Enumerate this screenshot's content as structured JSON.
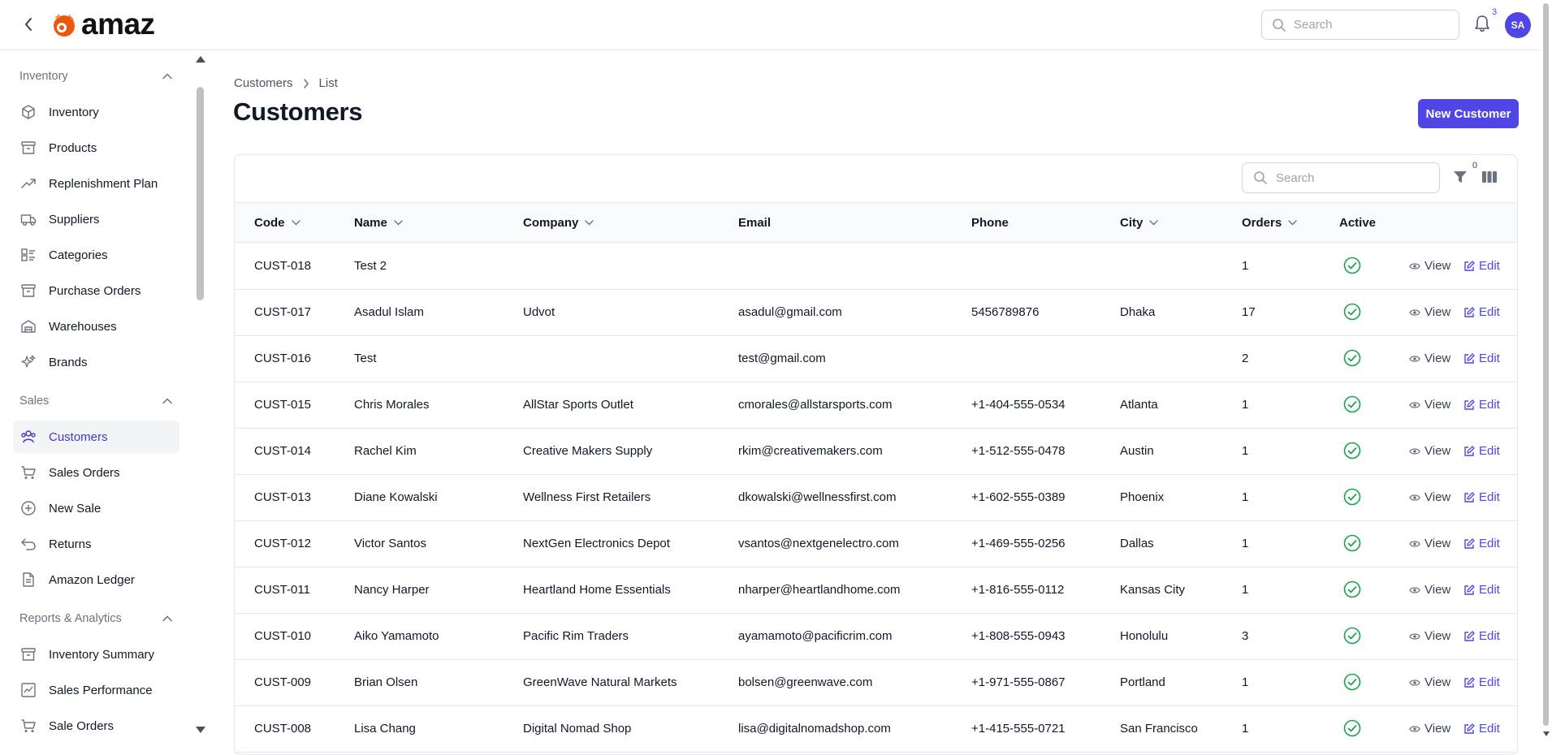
{
  "app": {
    "logo_text": "amaz",
    "notification_count": "3",
    "avatar_initials": "SA",
    "search_placeholder": "Search"
  },
  "sidebar": {
    "sections": [
      {
        "title": "Inventory",
        "items": [
          "Inventory",
          "Products",
          "Replenishment Plan",
          "Suppliers",
          "Categories",
          "Purchase Orders",
          "Warehouses",
          "Brands"
        ]
      },
      {
        "title": "Sales",
        "items": [
          "Customers",
          "Sales Orders",
          "New Sale",
          "Returns",
          "Amazon Ledger"
        ]
      },
      {
        "title": "Reports & Analytics",
        "items": [
          "Inventory Summary",
          "Sales Performance",
          "Sale Orders"
        ]
      }
    ],
    "active_item": "Customers"
  },
  "breadcrumb": {
    "root": "Customers",
    "current": "List"
  },
  "page": {
    "title": "Customers",
    "new_button": "New Customer"
  },
  "table": {
    "search_placeholder": "Search",
    "filter_count": "0",
    "columns": [
      "Code",
      "Name",
      "Company",
      "Email",
      "Phone",
      "City",
      "Orders",
      "Active"
    ],
    "view_label": "View",
    "edit_label": "Edit",
    "rows": [
      {
        "code": "CUST-018",
        "name": "Test 2",
        "company": "",
        "email": "",
        "phone": "",
        "city": "",
        "orders": "1",
        "active": true
      },
      {
        "code": "CUST-017",
        "name": "Asadul Islam",
        "company": "Udvot",
        "email": "asadul@gmail.com",
        "phone": "5456789876",
        "city": "Dhaka",
        "orders": "17",
        "active": true
      },
      {
        "code": "CUST-016",
        "name": "Test",
        "company": "",
        "email": "test@gmail.com",
        "phone": "",
        "city": "",
        "orders": "2",
        "active": true
      },
      {
        "code": "CUST-015",
        "name": "Chris Morales",
        "company": "AllStar Sports Outlet",
        "email": "cmorales@allstarsports.com",
        "phone": "+1-404-555-0534",
        "city": "Atlanta",
        "orders": "1",
        "active": true
      },
      {
        "code": "CUST-014",
        "name": "Rachel Kim",
        "company": "Creative Makers Supply",
        "email": "rkim@creativemakers.com",
        "phone": "+1-512-555-0478",
        "city": "Austin",
        "orders": "1",
        "active": true
      },
      {
        "code": "CUST-013",
        "name": "Diane Kowalski",
        "company": "Wellness First Retailers",
        "email": "dkowalski@wellnessfirst.com",
        "phone": "+1-602-555-0389",
        "city": "Phoenix",
        "orders": "1",
        "active": true
      },
      {
        "code": "CUST-012",
        "name": "Victor Santos",
        "company": "NextGen Electronics Depot",
        "email": "vsantos@nextgenelectro.com",
        "phone": "+1-469-555-0256",
        "city": "Dallas",
        "orders": "1",
        "active": true
      },
      {
        "code": "CUST-011",
        "name": "Nancy Harper",
        "company": "Heartland Home Essentials",
        "email": "nharper@heartlandhome.com",
        "phone": "+1-816-555-0112",
        "city": "Kansas City",
        "orders": "1",
        "active": true
      },
      {
        "code": "CUST-010",
        "name": "Aiko Yamamoto",
        "company": "Pacific Rim Traders",
        "email": "ayamamoto@pacificrim.com",
        "phone": "+1-808-555-0943",
        "city": "Honolulu",
        "orders": "3",
        "active": true
      },
      {
        "code": "CUST-009",
        "name": "Brian Olsen",
        "company": "GreenWave Natural Markets",
        "email": "bolsen@greenwave.com",
        "phone": "+1-971-555-0867",
        "city": "Portland",
        "orders": "1",
        "active": true
      },
      {
        "code": "CUST-008",
        "name": "Lisa Chang",
        "company": "Digital Nomad Shop",
        "email": "lisa@digitalnomadshop.com",
        "phone": "+1-415-555-0721",
        "city": "San Francisco",
        "orders": "1",
        "active": true
      }
    ]
  },
  "colors": {
    "accent": "#4f46e5",
    "active_check": "#16a34a",
    "border": "#e5e7eb"
  }
}
